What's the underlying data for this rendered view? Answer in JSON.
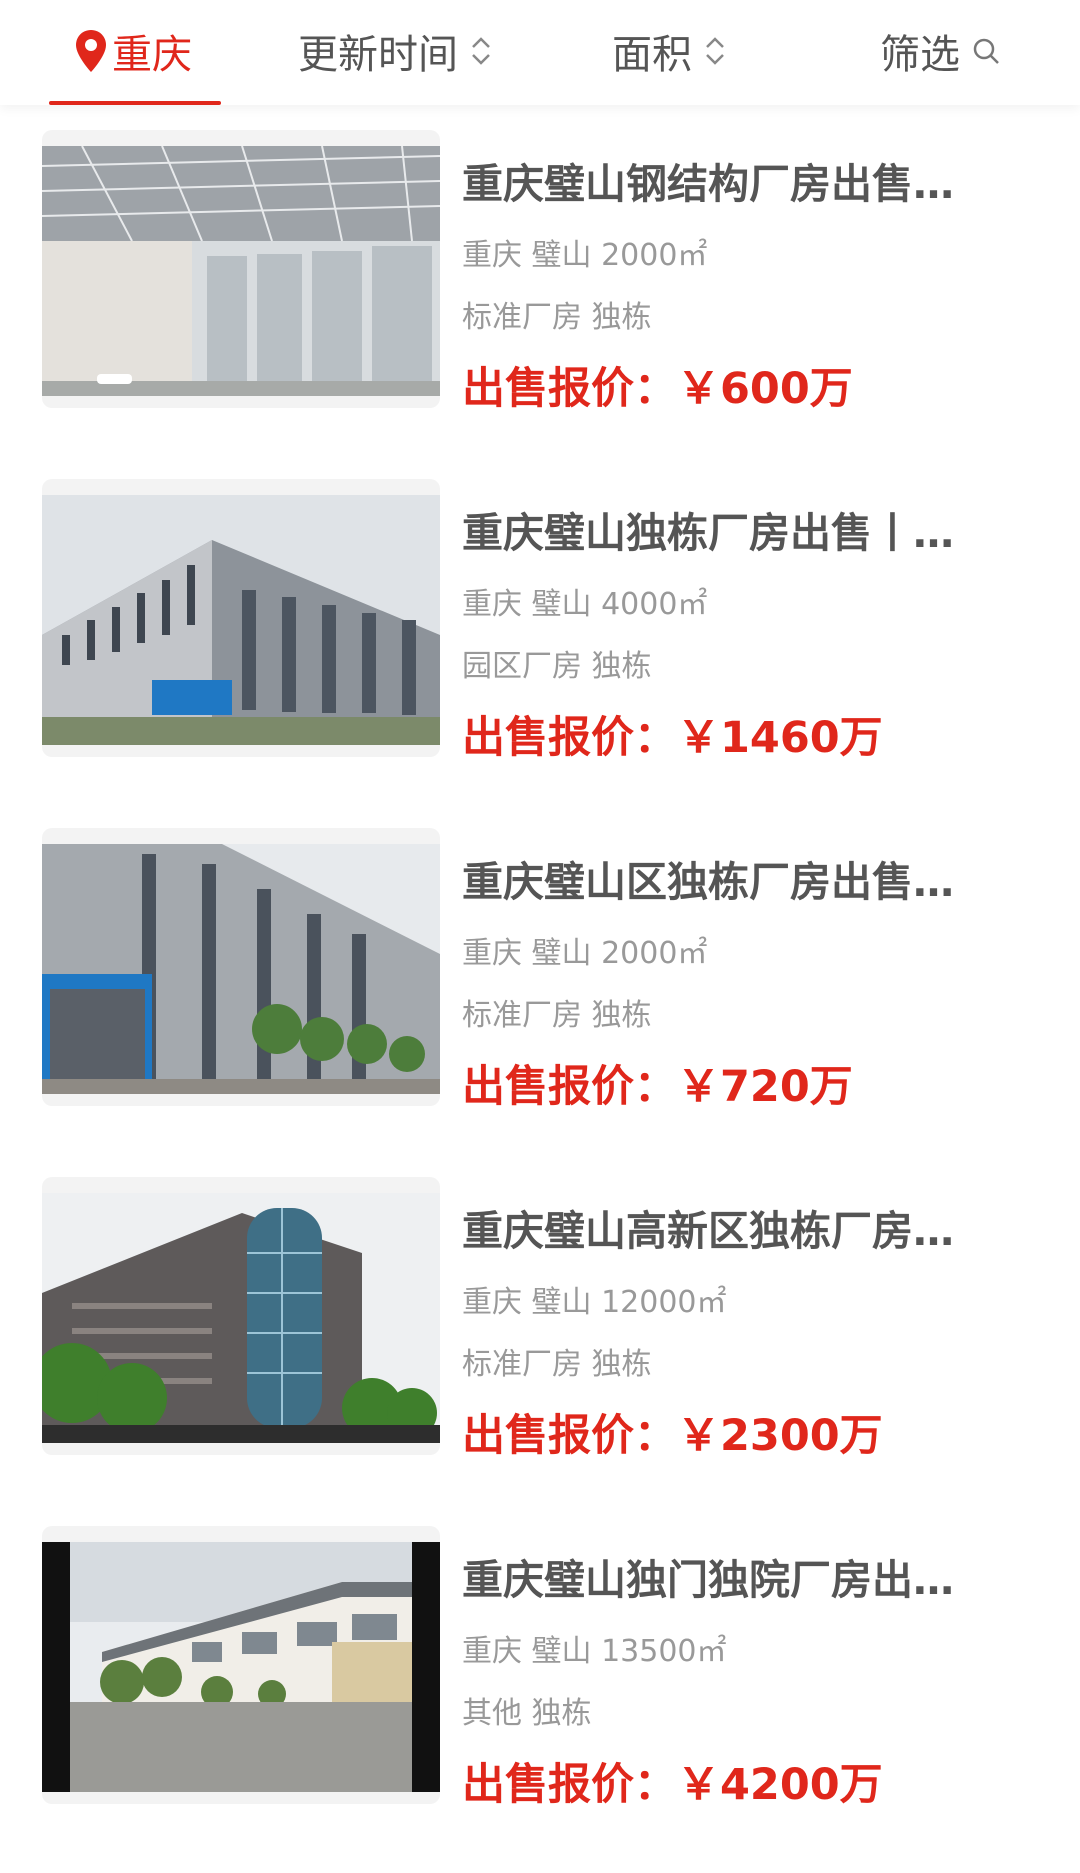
{
  "header": {
    "city": "重庆",
    "sort_update": "更新时间",
    "sort_area": "面积",
    "filter": "筛选"
  },
  "colors": {
    "accent": "#e0271b",
    "text": "#555555",
    "muted": "#999999"
  },
  "listings": [
    {
      "title": "重庆璧山钢结构厂房出售…",
      "location": "重庆 璧山 2000㎡",
      "tags": "标准厂房 独栋",
      "price_label": "出售报价：",
      "price": "￥600万",
      "image": "steel-warehouse-interior-photo"
    },
    {
      "title": "重庆璧山独栋厂房出售丨…",
      "location": "重庆 璧山 4000㎡",
      "tags": "园区厂房 独栋",
      "price_label": "出售报价：",
      "price": "￥1460万",
      "image": "grey-factory-building-photo"
    },
    {
      "title": "重庆璧山区独栋厂房出售…",
      "location": "重庆 璧山 2000㎡",
      "tags": "标准厂房 独栋",
      "price_label": "出售报价：",
      "price": "￥720万",
      "image": "factory-facade-with-trees-photo"
    },
    {
      "title": "重庆璧山高新区独栋厂房…",
      "location": "重庆 璧山 12000㎡",
      "tags": "标准厂房 独栋",
      "price_label": "出售报价：",
      "price": "￥2300万",
      "image": "glass-tower-factory-photo"
    },
    {
      "title": "重庆璧山独门独院厂房出…",
      "location": "重庆 璧山 13500㎡",
      "tags": "其他 独栋",
      "price_label": "出售报价：",
      "price": "￥4200万",
      "image": "factory-courtyard-photo"
    }
  ]
}
